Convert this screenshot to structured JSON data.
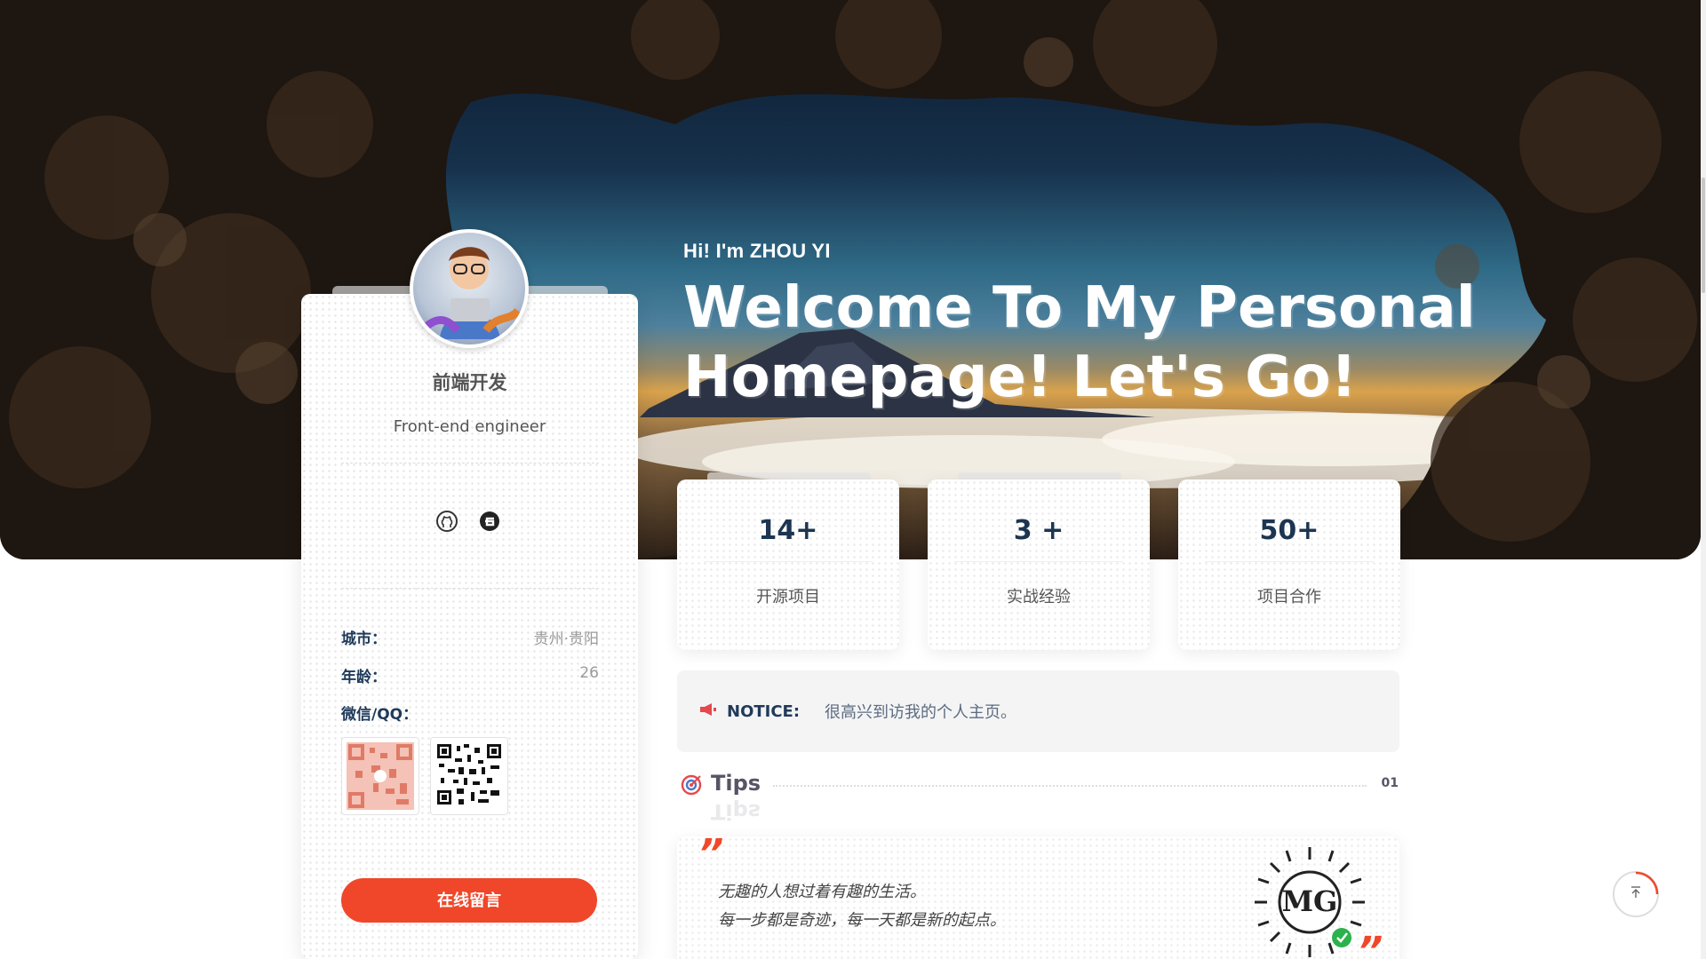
{
  "hero": {
    "greeting": "Hi! I'm ZHOU YI",
    "welcome": "Welcome To My Personal Homepage! Let's Go!"
  },
  "profile": {
    "name": "前端开发",
    "role": "Front-end engineer",
    "social_icons": [
      "github-icon",
      "gitee-icon"
    ],
    "info": [
      {
        "key": "城市：",
        "value": "贵州·贵阳"
      },
      {
        "key": "年龄：",
        "value": "26"
      },
      {
        "key": "微信/QQ：",
        "value": ""
      }
    ],
    "qr_labels": [
      "wechat-qr-icon",
      "qq-qr-icon"
    ],
    "message_button": "在线留言"
  },
  "stats": [
    {
      "number": "14+",
      "label": "开源项目"
    },
    {
      "number": "3 +",
      "label": "实战经验"
    },
    {
      "number": "50+",
      "label": "项目合作"
    }
  ],
  "notice": {
    "title": "NOTICE:",
    "text": "很高兴到访我的个人主页。"
  },
  "tips": {
    "title": "Tips",
    "count": "01",
    "quote_open": "”",
    "quote_close": "”",
    "lines": [
      "无趣的人想过着有趣的生活。",
      "每一步都是奇迹，每一天都是新的起点。"
    ],
    "logo": "MG"
  },
  "colors": {
    "accent": "#f0472a",
    "heading": "#1c3550"
  }
}
